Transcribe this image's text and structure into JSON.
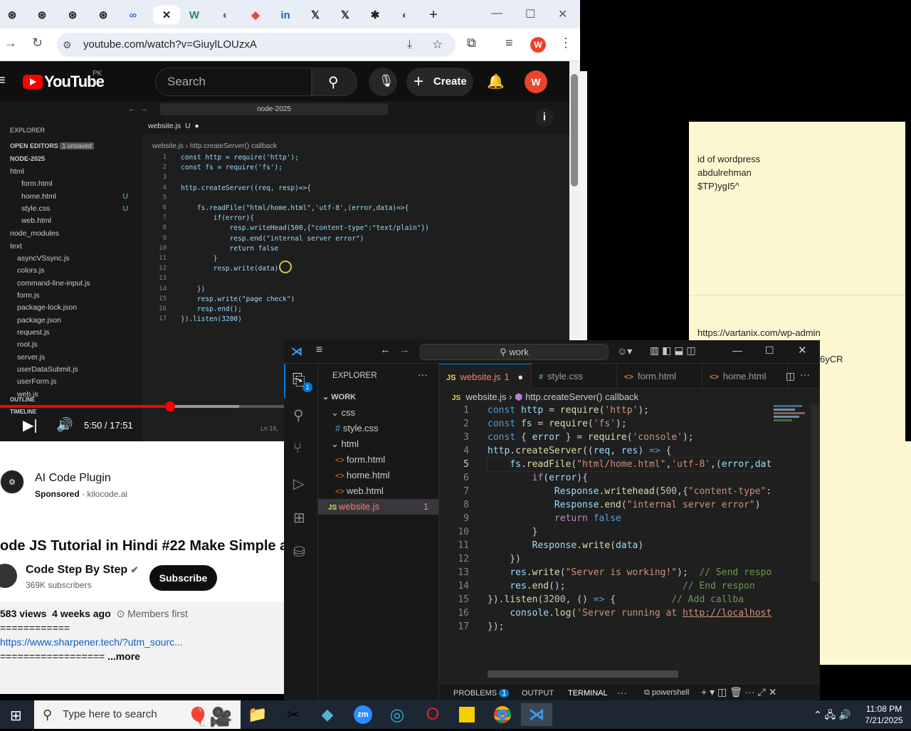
{
  "browser": {
    "url": "youtube.com/watch?v=GiuylLOUzxA",
    "profile_initial": "W"
  },
  "youtube": {
    "logo_text": "YouTube",
    "country": "PK",
    "search_placeholder": "Search",
    "create_label": "Create",
    "avatar_initial": "W",
    "time": "5:50 / 17:51",
    "ad_title": "AI Code Plugin",
    "ad_sponsored": "Sponsored",
    "ad_domain": "kilocode.ai",
    "video_title": "ode JS Tutorial in Hindi #22 Make Simple and",
    "channel_name": "Code Step By Step",
    "subscribers": "369K subscribers",
    "subscribe_label": "Subscribe",
    "views": "583 views",
    "age": "4 weeks ago",
    "members": "Members first",
    "desc_sep": "============",
    "desc_link": "https://www.sharpener.tech/?utm_sourc...",
    "desc_sep2": "==================",
    "more": "...more"
  },
  "video_vscode": {
    "search": "node-2025",
    "explorer": "EXPLORER",
    "open_editors": "OPEN EDITORS",
    "unsaved": "1 unsaved",
    "root": "NODE-2025",
    "tab": "website.js",
    "tab_status": "U",
    "breadcrumb_file": "website.js",
    "breadcrumb_fn": "http.createServer() callback",
    "files": [
      {
        "name": "html",
        "status": ""
      },
      {
        "name": "form.html",
        "status": ""
      },
      {
        "name": "home.html",
        "status": "U"
      },
      {
        "name": "style.css",
        "status": "U"
      },
      {
        "name": "web.html",
        "status": ""
      },
      {
        "name": "node_modules",
        "status": ""
      },
      {
        "name": "text",
        "status": ""
      },
      {
        "name": "asyncVSsync.js",
        "status": ""
      },
      {
        "name": "colors.js",
        "status": ""
      },
      {
        "name": "command-line-input.js",
        "status": ""
      },
      {
        "name": "form.js",
        "status": ""
      },
      {
        "name": "package-lock.json",
        "status": ""
      },
      {
        "name": "package.json",
        "status": ""
      },
      {
        "name": "request.js",
        "status": ""
      },
      {
        "name": "root.js",
        "status": ""
      },
      {
        "name": "server.js",
        "status": ""
      },
      {
        "name": "userDataSubmit.js",
        "status": ""
      },
      {
        "name": "userForm.js",
        "status": ""
      },
      {
        "name": "web.js",
        "status": ""
      }
    ],
    "outline": "OUTLINE",
    "timeline": "TIMELINE",
    "status_right": "Ln 16,",
    "code": [
      "const http = require('http');",
      "const fs = require('fs');",
      "",
      "http.createServer((req, resp)=>{",
      "",
      "    fs.readFile(\"html/home.html\",'utf-8',(error,data)=>{",
      "        if(error){",
      "            resp.writeHead(500,{\"content-type\":\"text/plain\"})",
      "            resp.end(\"internal server error\")",
      "            return false",
      "        }",
      "        resp.write(data)",
      "",
      "    })",
      "    resp.write(\"page check\")",
      "    resp.end();",
      "}).listen(3200)"
    ]
  },
  "sticky": {
    "note1_lines": [
      "id of wordpress",
      "abdulrehman",
      "$TP)ygI5^"
    ],
    "note2_line": "https://vartanix.com/wp-admin",
    "note2_partial": "6yCR"
  },
  "vscode": {
    "search": "work",
    "explorer": "EXPLORER",
    "workspace": "WORK",
    "badge": "1",
    "tree": [
      {
        "name": "css",
        "type": "folder"
      },
      {
        "name": "style.css",
        "type": "css"
      },
      {
        "name": "html",
        "type": "folder"
      },
      {
        "name": "form.html",
        "type": "html"
      },
      {
        "name": "home.html",
        "type": "html"
      },
      {
        "name": "web.html",
        "type": "html"
      },
      {
        "name": "website.js",
        "type": "js",
        "problems": "1"
      }
    ],
    "tabs": [
      {
        "label": "website.js",
        "suffix": "1",
        "icon": "JS"
      },
      {
        "label": "style.css",
        "icon": "#"
      },
      {
        "label": "form.html",
        "icon": "<>"
      },
      {
        "label": "home.html",
        "icon": "<>"
      }
    ],
    "breadcrumb_file": "website.js",
    "breadcrumb_fn": "http.createServer() callback",
    "line_numbers": [
      "1",
      "2",
      "3",
      "4",
      "5",
      "6",
      "7",
      "8",
      "9",
      "10",
      "11",
      "12",
      "13",
      "14",
      "15",
      "16",
      "17"
    ],
    "panel_tabs": {
      "problems": "PROBLEMS",
      "problems_count": "1",
      "output": "OUTPUT",
      "terminal": "TERMINAL"
    },
    "terminal_name": "powershell"
  },
  "taskbar": {
    "search_placeholder": "Type here to search",
    "time": "11:08 PM",
    "date": "7/21/2025"
  }
}
